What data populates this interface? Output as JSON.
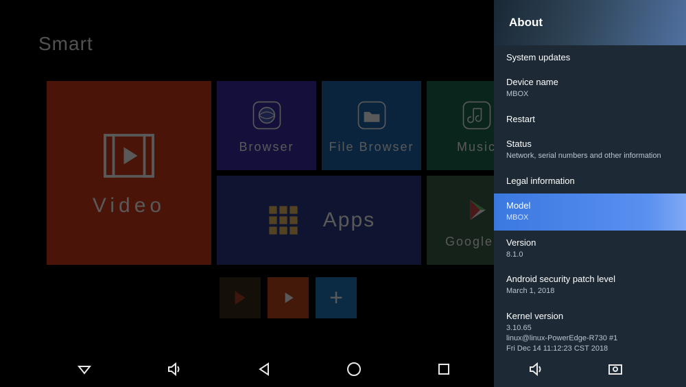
{
  "brand": "Smart",
  "tiles": {
    "video": "Video",
    "browser": "Browser",
    "filebrowser": "File Browser",
    "music": "Music",
    "apps": "Apps",
    "play": "Google S"
  },
  "dock": {
    "add": "+"
  },
  "about": {
    "header": "About",
    "items": [
      {
        "title": "System updates",
        "sub": ""
      },
      {
        "title": "Device name",
        "sub": "MBOX"
      },
      {
        "title": "Restart",
        "sub": ""
      },
      {
        "title": "Status",
        "sub": "Network, serial numbers and other information"
      },
      {
        "title": "Legal information",
        "sub": ""
      },
      {
        "title": "Model",
        "sub": "MBOX"
      },
      {
        "title": "Version",
        "sub": "8.1.0"
      },
      {
        "title": "Android security patch level",
        "sub": "March 1, 2018"
      },
      {
        "title": "Kernel version",
        "sub": "3.10.65\nlinux@linux-PowerEdge-R730 #1\nFri Dec 14 11:12:23 CST 2018"
      }
    ],
    "selected_index": 5
  }
}
